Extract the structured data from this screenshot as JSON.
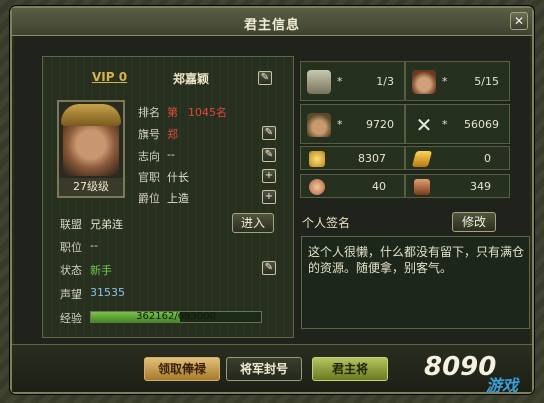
{
  "title": "君主信息",
  "close_label": "✕",
  "profile": {
    "vip": "VIP 0",
    "name": "郑嘉颖",
    "level_label": "27级级",
    "rank_label": "排名",
    "rank_prefix": "第",
    "rank_value": "1045名",
    "flag_label": "旗号",
    "flag_value": "郑",
    "will_label": "志向",
    "will_value": "--",
    "office_label": "官职",
    "office_value": "什长",
    "title_label": "爵位",
    "title_value": "上造",
    "alliance_label": "联盟",
    "alliance_value": "兄弟连",
    "enter_button": "进入",
    "position_label": "职位",
    "position_value": "--",
    "status_label": "状态",
    "status_value": "新手",
    "prestige_label": "声望",
    "prestige_value": "31535",
    "xp_label": "经验",
    "xp_text": "362162/693000",
    "xp_fraction": 0.5226
  },
  "stats": [
    {
      "icon": "city-icon",
      "star": "*",
      "value": "1/3"
    },
    {
      "icon": "general-icon",
      "star": "*",
      "value": "5/15"
    },
    {
      "icon": "soldier-icon",
      "star": "*",
      "value": "9720"
    },
    {
      "icon": "crossed-swords-icon",
      "star": "*",
      "value": "56069"
    }
  ],
  "resources": [
    {
      "icon": "gold-icon",
      "value": "8307"
    },
    {
      "icon": "gold-bar-icon",
      "value": "0"
    },
    {
      "icon": "food-icon",
      "value": "40"
    },
    {
      "icon": "house-icon",
      "value": "349"
    }
  ],
  "signature": {
    "title": "个人签名",
    "edit_button": "修改",
    "text": "这个人很懒，什么都没有留下，只有满仓的资源。随便拿，别客气。"
  },
  "bottom_buttons": {
    "salary": "领取俸禄",
    "promote": "将军封号",
    "lord": "君主将"
  },
  "watermark": "8090",
  "watermark_sub": "游戏"
}
